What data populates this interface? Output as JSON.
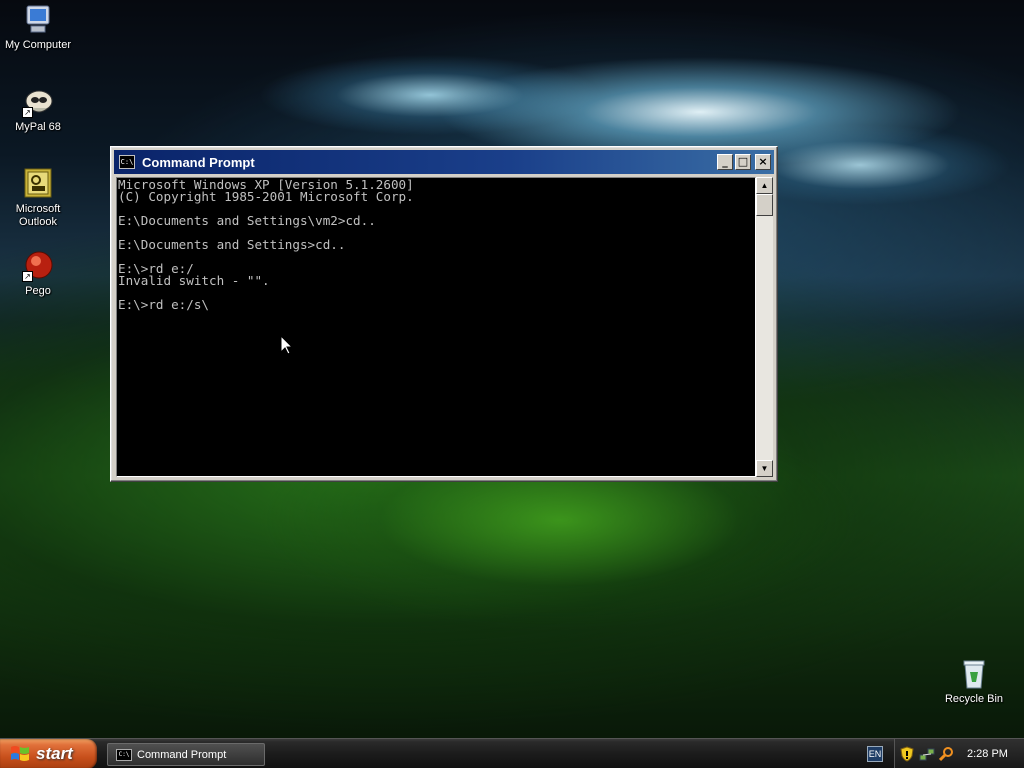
{
  "desktop": {
    "icons": [
      {
        "label": "My Computer",
        "icon": "my-computer-icon"
      },
      {
        "label": "MyPal 68",
        "icon": "mypal-browser-icon"
      },
      {
        "label": "Microsoft Outlook",
        "label_lines": [
          "Microsoft",
          "Outlook"
        ],
        "icon": "outlook-icon"
      },
      {
        "label": "Pego",
        "icon": "pego-icon"
      },
      {
        "label": "Recycle Bin",
        "icon": "recycle-bin-icon"
      }
    ]
  },
  "window": {
    "title": "Command Prompt",
    "icon_text": "C:\\",
    "buttons": {
      "minimize": "_",
      "maximize": "□",
      "close": "×"
    },
    "console_lines": [
      "Microsoft Windows XP [Version 5.1.2600]",
      "(C) Copyright 1985-2001 Microsoft Corp.",
      "",
      "E:\\Documents and Settings\\vm2>cd..",
      "",
      "E:\\Documents and Settings>cd..",
      "",
      "E:\\>rd e:/",
      "Invalid switch - \"\".",
      "",
      "E:\\>rd e:/s\\"
    ],
    "scrollbar": {
      "up_glyph": "▲",
      "down_glyph": "▼"
    },
    "colors": {
      "title_start": "#0a246a",
      "title_end": "#3a6ea5",
      "console_bg": "#000000",
      "console_fg": "#c0c0c0"
    }
  },
  "taskbar": {
    "start_label": "start",
    "tasks": [
      {
        "label": "Command Prompt",
        "icon": "command-prompt-icon"
      }
    ],
    "language": "EN",
    "tray_icons": [
      "security-shield-icon",
      "network-icon",
      "search-icon"
    ],
    "clock": "2:28 PM"
  }
}
